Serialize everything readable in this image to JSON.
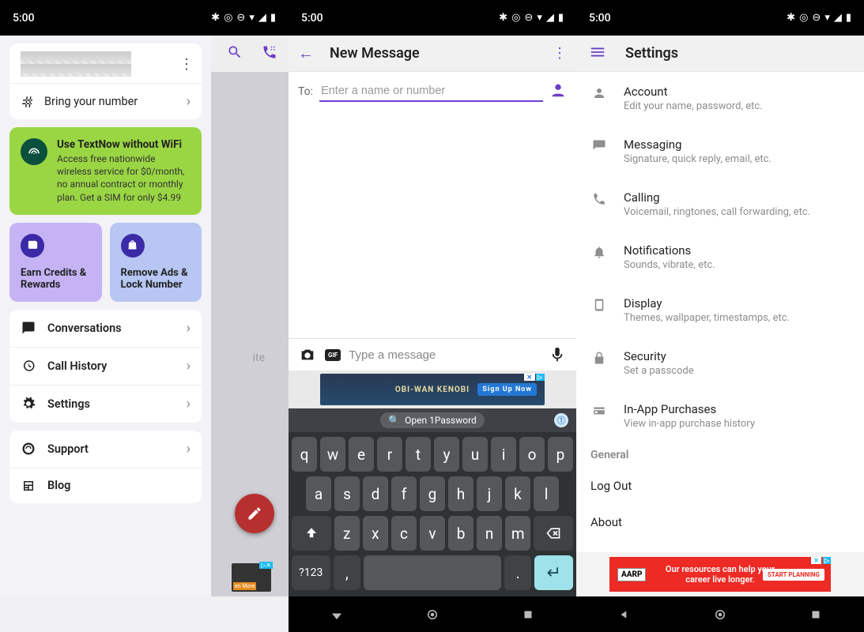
{
  "status": {
    "time": "5:00"
  },
  "screen1": {
    "bring_number": "Bring your number",
    "promo_title": "Use TextNow without WiFi",
    "promo_desc": "Access free nationwide wireless service for $0/month, no annual contract or monthly plan. Get a SIM for only $4.99",
    "card_earn": "Earn Credits & Rewards",
    "card_remove": "Remove Ads & Lock Number",
    "menu": {
      "conversations": "Conversations",
      "call_history": "Call History",
      "settings": "Settings",
      "support": "Support",
      "blog": "Blog"
    },
    "backdrop_text": "ite",
    "smallad_btn": "en More"
  },
  "screen2": {
    "title": "New Message",
    "to_label": "To:",
    "to_placeholder": "Enter a name or number",
    "compose_placeholder": "Type a message",
    "gif_label": "GIF",
    "onepassword": "Open 1Password",
    "ad_text": "OBI-WAN KENOBI",
    "ad_button": "Sign Up Now",
    "keys_r1": [
      "q",
      "w",
      "e",
      "r",
      "t",
      "y",
      "u",
      "i",
      "o",
      "p"
    ],
    "keys_r2": [
      "a",
      "s",
      "d",
      "f",
      "g",
      "h",
      "j",
      "k",
      "l"
    ],
    "keys_r3": [
      "z",
      "x",
      "c",
      "v",
      "b",
      "n",
      "m"
    ],
    "key_symbols": "?123",
    "key_comma": ",",
    "key_period": "."
  },
  "screen3": {
    "title": "Settings",
    "items": [
      {
        "label": "Account",
        "sub": "Edit your name, password, etc."
      },
      {
        "label": "Messaging",
        "sub": "Signature, quick reply, email, etc."
      },
      {
        "label": "Calling",
        "sub": "Voicemail, ringtones, call forwarding, etc."
      },
      {
        "label": "Notifications",
        "sub": "Sounds, vibrate, etc."
      },
      {
        "label": "Display",
        "sub": "Themes, wallpaper, timestamps, etc."
      },
      {
        "label": "Security",
        "sub": "Set a passcode"
      },
      {
        "label": "In-App Purchases",
        "sub": "View in-app purchase history"
      }
    ],
    "section": "General",
    "logout": "Log Out",
    "about": "About",
    "ad_label": "AARP",
    "ad_text": "Our resources can help your career live longer.",
    "ad_button": "START PLANNING"
  }
}
